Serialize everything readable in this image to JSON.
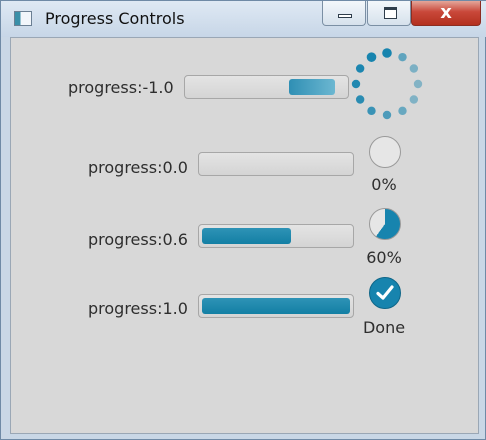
{
  "window": {
    "title": "Progress Controls",
    "close_glyph": "x"
  },
  "rows": [
    {
      "label": "progress:-1.0",
      "progress": -1.0,
      "indicator_text": ""
    },
    {
      "label": "progress:0.0",
      "progress": 0.0,
      "indicator_text": "0%"
    },
    {
      "label": "progress:0.6",
      "progress": 0.6,
      "indicator_text": "60%"
    },
    {
      "label": "progress:1.0",
      "progress": 1.0,
      "indicator_text": "Done"
    }
  ],
  "colors": {
    "accent": "#1784ae",
    "track": "#d8d8d8"
  }
}
